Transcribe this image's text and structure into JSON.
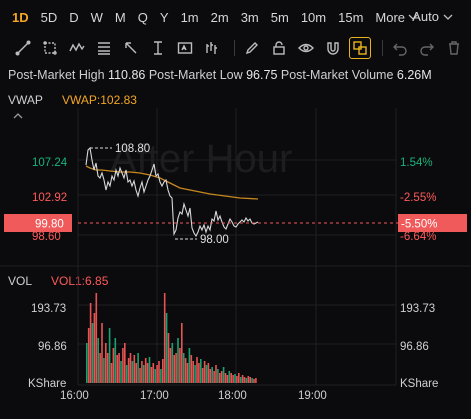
{
  "timeframes": [
    "1D",
    "5D",
    "D",
    "W",
    "M",
    "Q",
    "Y",
    "1m",
    "2m",
    "3m",
    "5m",
    "10m",
    "15m"
  ],
  "active_timeframe": "1D",
  "more_label": "More",
  "auto_label": "Auto",
  "tools": [
    "line-tool-icon",
    "rect-select-icon",
    "wave-icon",
    "fib-icon",
    "arrow-icon",
    "measure-icon",
    "text-box-icon",
    "bars-icon",
    "pen-icon",
    "lock-icon",
    "eye-icon",
    "magnet-icon",
    "layers-icon",
    "undo-icon",
    "redo-icon",
    "trash-icon"
  ],
  "stats": {
    "high_label": "Post-Market High",
    "high_value": "110.86",
    "low_label": "Post-Market Low",
    "low_value": "96.75",
    "volume_label": "Post-Market Volume",
    "volume_value": "6.26M"
  },
  "price_panel": {
    "indicator": "VWAP",
    "vwap_label": "VWAP:102.83",
    "watermark": "After Hour",
    "left_ticks": [
      "107.24",
      "102.92",
      "98.60"
    ],
    "right_ticks": [
      "1.54%",
      "-2.55%",
      "-6.64%"
    ],
    "current_price": "99.80",
    "current_pct": "-5.50%",
    "high_annotation": "108.80",
    "low_annotation": "98.00"
  },
  "volume_panel": {
    "indicator": "VOL",
    "vol_label": "VOL1:6.85",
    "left_ticks": [
      "193.73",
      "96.86",
      "KShare"
    ],
    "right_ticks": [
      "193.73",
      "96.86",
      "KShare"
    ]
  },
  "time_axis": [
    "16:00",
    "17:00",
    "18:00",
    "19:00"
  ],
  "colors": {
    "accent": "#f5a623",
    "up": "#19b37a",
    "down": "#ff5a5a",
    "current_bg": "#f05a5a",
    "vwap_line": "#c8881e"
  }
}
